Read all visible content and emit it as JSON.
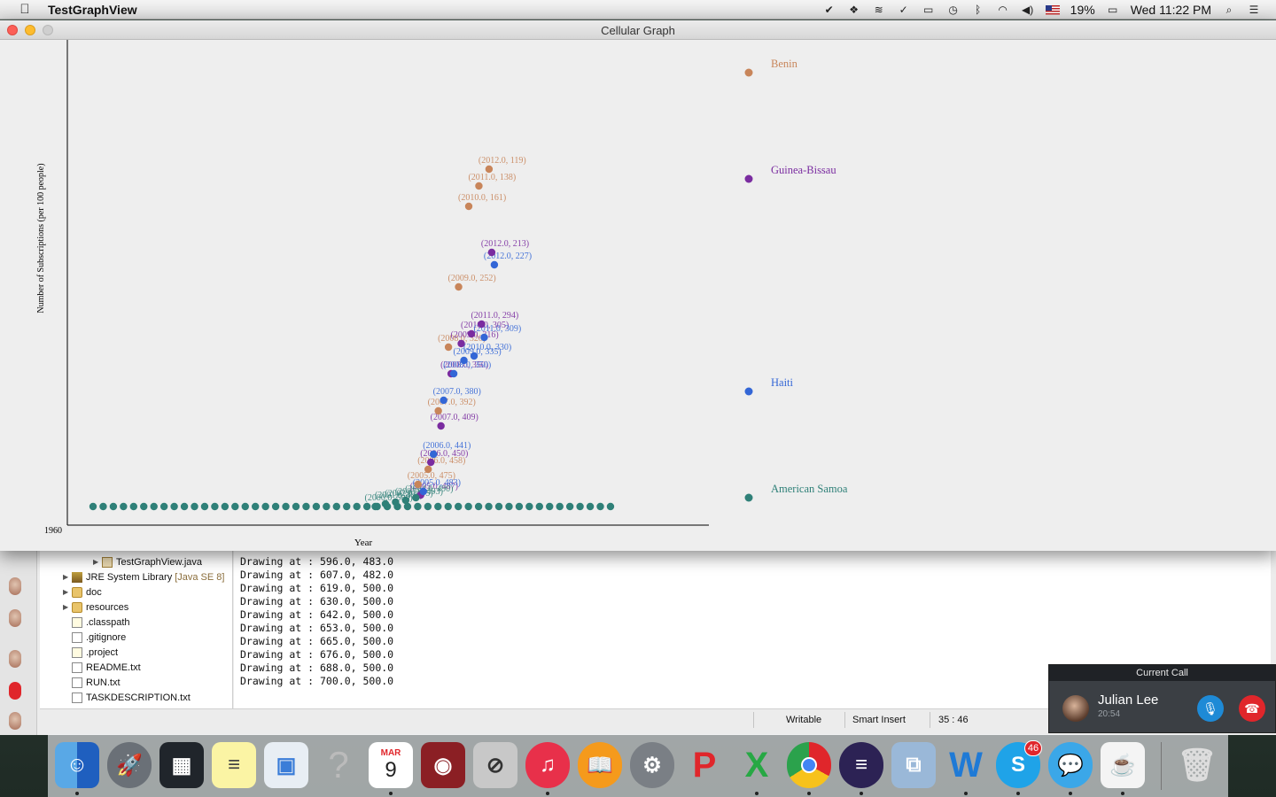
{
  "menubar": {
    "app_name": "TestGraphView",
    "battery": "19%",
    "clock": "Wed 11:22 PM"
  },
  "window": {
    "title": "Cellular Graph"
  },
  "chart_data": {
    "type": "scatter",
    "xlabel": "Year",
    "ylabel": "Number of Subscriptions (per 100 people)",
    "x_tick_label": "1960",
    "x_range": [
      1960,
      2012
    ],
    "y_range": [
      0,
      500
    ],
    "series": [
      {
        "name": "Benin",
        "color": "#c8855a",
        "points": [
          [
            2005,
            475
          ],
          [
            2006,
            458
          ],
          [
            2007,
            392
          ],
          [
            2008,
            320
          ],
          [
            2009,
            252
          ],
          [
            2010,
            161
          ],
          [
            2011,
            138
          ],
          [
            2012,
            119
          ]
        ]
      },
      {
        "name": "Guinea-Bissau",
        "color": "#7a2ca0",
        "points": [
          [
            2005,
            487
          ],
          [
            2006,
            450
          ],
          [
            2007,
            409
          ],
          [
            2008,
            350
          ],
          [
            2009,
            316
          ],
          [
            2010,
            305
          ],
          [
            2011,
            294
          ],
          [
            2012,
            213
          ]
        ]
      },
      {
        "name": "Haiti",
        "color": "#3366d6",
        "points": [
          [
            2005,
            483
          ],
          [
            2006,
            441
          ],
          [
            2007,
            380
          ],
          [
            2008,
            350
          ],
          [
            2009,
            335
          ],
          [
            2010,
            330
          ],
          [
            2011,
            309
          ],
          [
            2012,
            227
          ]
        ]
      },
      {
        "name": "American Samoa",
        "color": "#2f8078",
        "points": [
          [
            2000,
            500
          ],
          [
            2001,
            497
          ],
          [
            2002,
            495
          ],
          [
            2003,
            493
          ],
          [
            2004,
            490
          ]
        ]
      }
    ],
    "annotations": [
      "(2012.0, 119)",
      "(2011.0, 138)",
      "(2010.0, 161)",
      "(2012.0, 213)",
      "(2012.0, 227)",
      "(2009.0, 252)",
      "(2011.0, 294)",
      "(2010.0, 305)",
      "(2009.0, 316)",
      "(2011.0, 309)",
      "(2008.0, 320)",
      "(2009.0, 335)",
      "(2008.0, 350)",
      "(2007.0, 380)",
      "(2007.0, 392)",
      "(2007.0, 409)",
      "(2006.0, 441)",
      "(2006.0, 450)",
      "(2006.0, 458)",
      "(2005.0, 475)",
      "(2005.0, 483)",
      "(2005.0, 487)"
    ],
    "grid": false,
    "legend_position": "right"
  },
  "explorer": {
    "items": [
      {
        "label": "TestGraphView.java",
        "suffix": "",
        "icon": "java-file-icon",
        "tri": "▶",
        "indent": 60
      },
      {
        "label": "JRE System Library",
        "suffix": "[Java SE 8]",
        "icon": "library-icon",
        "tri": "▶",
        "indent": 26
      },
      {
        "label": "doc",
        "suffix": "",
        "icon": "folder-icon",
        "tri": "▶",
        "indent": 26
      },
      {
        "label": "resources",
        "suffix": "",
        "icon": "folder-icon",
        "tri": "▶",
        "indent": 26
      },
      {
        "label": ".classpath",
        "suffix": "",
        "icon": "xml-file-icon",
        "tri": "",
        "indent": 26
      },
      {
        "label": ".gitignore",
        "suffix": "",
        "icon": "text-file-icon",
        "tri": "",
        "indent": 26
      },
      {
        "label": ".project",
        "suffix": "",
        "icon": "xml-file-icon",
        "tri": "",
        "indent": 26
      },
      {
        "label": "README.txt",
        "suffix": "",
        "icon": "text-file-icon",
        "tri": "",
        "indent": 26
      },
      {
        "label": "RUN.txt",
        "suffix": "",
        "icon": "text-file-icon",
        "tri": "",
        "indent": 26
      },
      {
        "label": "TASKDESCRIPTION.txt",
        "suffix": "",
        "icon": "text-file-icon",
        "tri": "",
        "indent": 26
      }
    ]
  },
  "console": {
    "lines": [
      "Drawing at : 596.0, 483.0",
      "Drawing at : 607.0, 482.0",
      "Drawing at : 619.0, 500.0",
      "Drawing at : 630.0, 500.0",
      "Drawing at : 642.0, 500.0",
      "Drawing at : 653.0, 500.0",
      "Drawing at : 665.0, 500.0",
      "Drawing at : 676.0, 500.0",
      "Drawing at : 688.0, 500.0",
      "Drawing at : 700.0, 500.0"
    ]
  },
  "statusbar": {
    "writable": "Writable",
    "insert_mode": "Smart Insert",
    "position": "35 : 46"
  },
  "call": {
    "header": "Current Call",
    "name": "Julian Lee",
    "duration": "20:54"
  },
  "dock": {
    "calendar_month": "MAR",
    "calendar_day": "9",
    "skype_badge": "46"
  }
}
